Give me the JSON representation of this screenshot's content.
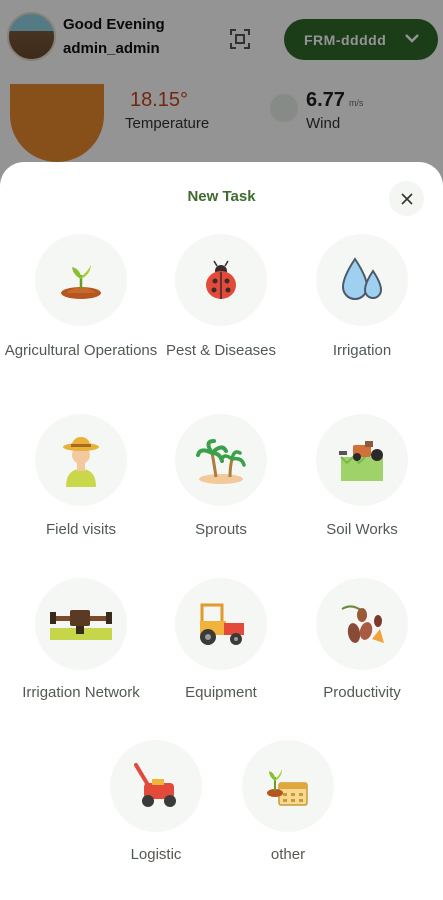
{
  "header": {
    "greeting": "Good Evening",
    "username": "admin_admin",
    "farm_selector": "FRM-ddddd"
  },
  "weather": {
    "temperature": "18.15°",
    "temperature_label": "Temperature",
    "wind": "6.77",
    "wind_unit": "m/s",
    "wind_label": "Wind"
  },
  "sheet": {
    "title": "New Task",
    "tasks": [
      {
        "label": "Agricultural Operations",
        "icon": "sprout-soil-icon"
      },
      {
        "label": "Pest & Diseases",
        "icon": "ladybug-icon"
      },
      {
        "label": "Irrigation",
        "icon": "water-drops-icon"
      },
      {
        "label": "Field visits",
        "icon": "farmer-icon"
      },
      {
        "label": "Sprouts",
        "icon": "palm-trees-icon"
      },
      {
        "label": "Soil Works",
        "icon": "soil-machine-icon"
      },
      {
        "label": "Irrigation Network",
        "icon": "pipe-network-icon"
      },
      {
        "label": "Equipment",
        "icon": "tractor-icon"
      },
      {
        "label": "Productivity",
        "icon": "dates-icon"
      },
      {
        "label": "Logistic",
        "icon": "lawn-mower-icon"
      },
      {
        "label": "other",
        "icon": "seedling-calendar-icon"
      }
    ]
  },
  "colors": {
    "brand_green": "#2f6a2a",
    "title_green": "#3f6b2f",
    "temperature": "#c4461a"
  }
}
